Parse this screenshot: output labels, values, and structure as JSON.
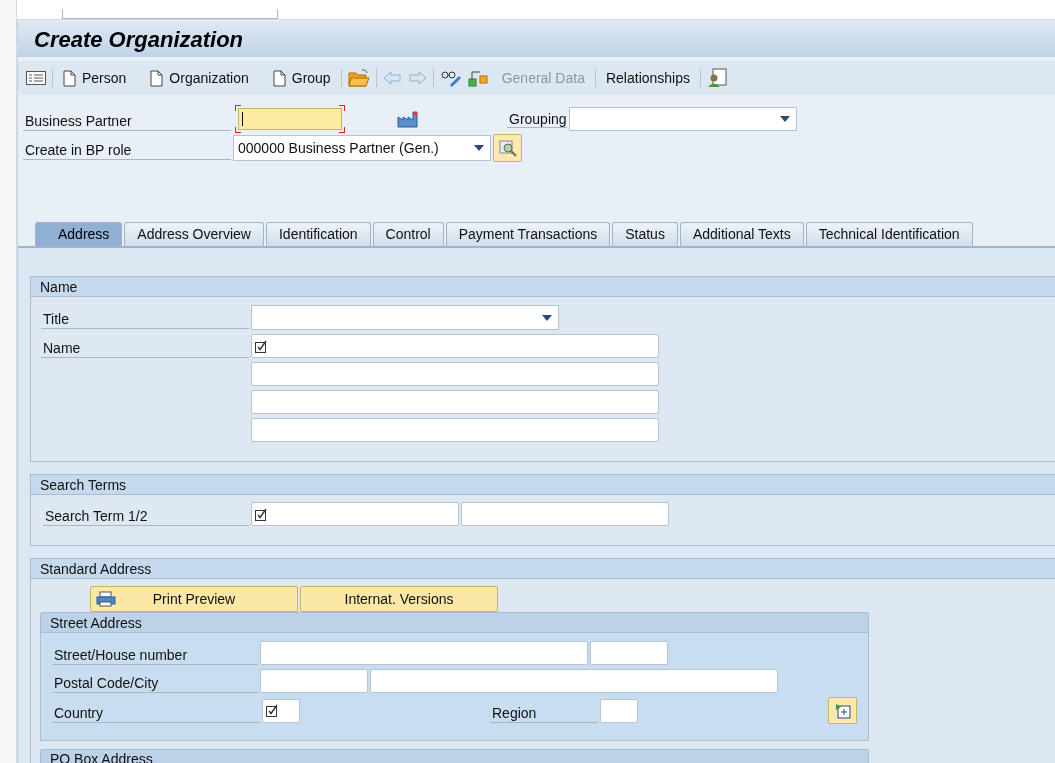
{
  "window": {
    "title": "Create Organization"
  },
  "toolbar": [
    {
      "label": "Person",
      "disabled": false
    },
    {
      "label": "Organization",
      "disabled": false
    },
    {
      "label": "Group",
      "disabled": false
    },
    {
      "label": "General Data",
      "disabled": true
    },
    {
      "label": "Relationships",
      "disabled": false
    }
  ],
  "header": {
    "business_partner": {
      "label": "Business Partner"
    },
    "grouping": {
      "label": "Grouping"
    },
    "bp_role": {
      "label": "Create in BP role",
      "value": "000000 Business Partner (Gen.)"
    }
  },
  "tabs": [
    {
      "label": "Address",
      "selected": true
    },
    {
      "label": "Address Overview",
      "selected": false
    },
    {
      "label": "Identification",
      "selected": false
    },
    {
      "label": "Control",
      "selected": false
    },
    {
      "label": "Payment Transactions",
      "selected": false
    },
    {
      "label": "Status",
      "selected": false
    },
    {
      "label": "Additional Texts",
      "selected": false
    },
    {
      "label": "Technical Identification",
      "selected": false
    }
  ],
  "name_section": {
    "title": "Name",
    "title_label": "Title",
    "name_label": "Name"
  },
  "search_terms": {
    "title": "Search Terms",
    "label": "Search Term 1/2"
  },
  "standard_address": {
    "title": "Standard Address",
    "buttons": [
      "Print Preview",
      "Internat. Versions"
    ],
    "street_address": {
      "title": "Street Address",
      "street_label": "Street/House number",
      "postal_label": "Postal Code/City",
      "country_label": "Country",
      "region_label": "Region"
    }
  },
  "po_box": {
    "title": "PO Box Address"
  }
}
